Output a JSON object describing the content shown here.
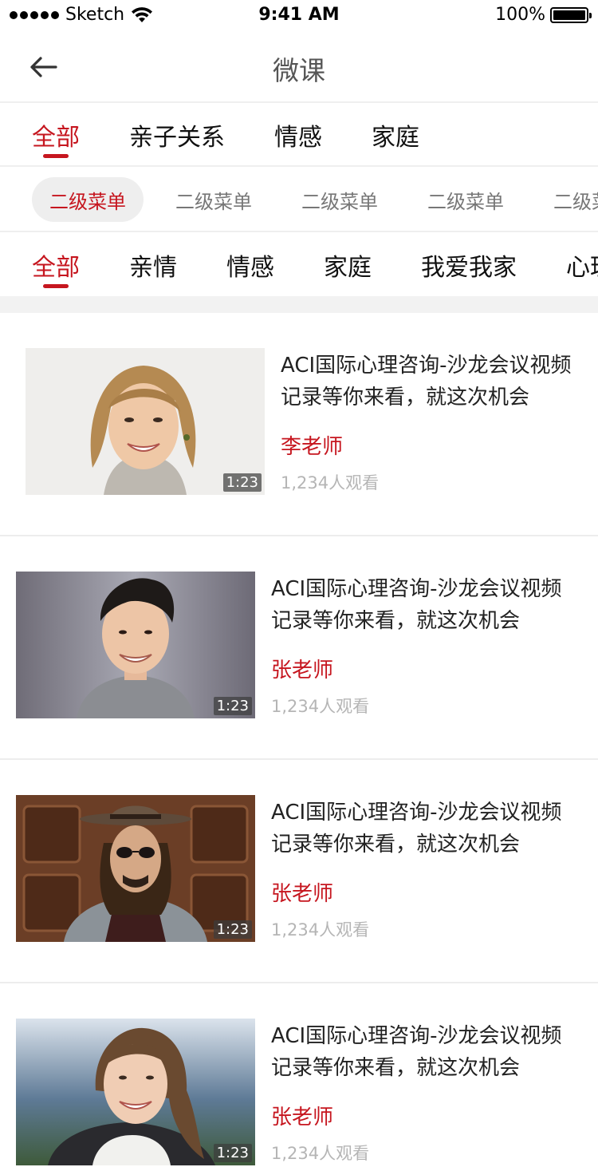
{
  "status_bar": {
    "carrier": "Sketch",
    "time": "9:41 AM",
    "battery": "100%",
    "battery_level": 1.0
  },
  "nav": {
    "title": "微课",
    "back_icon": "arrow-left-icon"
  },
  "primary_tabs": [
    "全部",
    "亲子关系",
    "情感",
    "家庭"
  ],
  "secondary_chips": [
    "二级菜单",
    "二级菜单",
    "二级菜单",
    "二级菜单",
    "二级菜单"
  ],
  "tertiary_tabs": [
    "全部",
    "亲情",
    "情感",
    "家庭",
    "我爱我家",
    "心理"
  ],
  "courses": [
    {
      "title": "ACI国际心理咨询-沙龙会议视频记录等你来看，就这次机会",
      "teacher": "李老师",
      "views": "1,234人观看",
      "duration": "1:23",
      "thumb": "woman-portrait-1"
    },
    {
      "title": "ACI国际心理咨询-沙龙会议视频记录等你来看，就这次机会",
      "teacher": "张老师",
      "views": "1,234人观看",
      "duration": "1:23",
      "thumb": "man-portrait-1"
    },
    {
      "title": "ACI国际心理咨询-沙龙会议视频记录等你来看，就这次机会",
      "teacher": "张老师",
      "views": "1,234人观看",
      "duration": "1:23",
      "thumb": "man-portrait-2"
    },
    {
      "title": "ACI国际心理咨询-沙龙会议视频记录等你来看，就这次机会",
      "teacher": "张老师",
      "views": "1,234人观看",
      "duration": "1:23",
      "thumb": "woman-portrait-2"
    }
  ],
  "colors": {
    "accent": "#c6161f",
    "muted": "#b5b5b5",
    "chip_bg": "#eeeeee"
  }
}
